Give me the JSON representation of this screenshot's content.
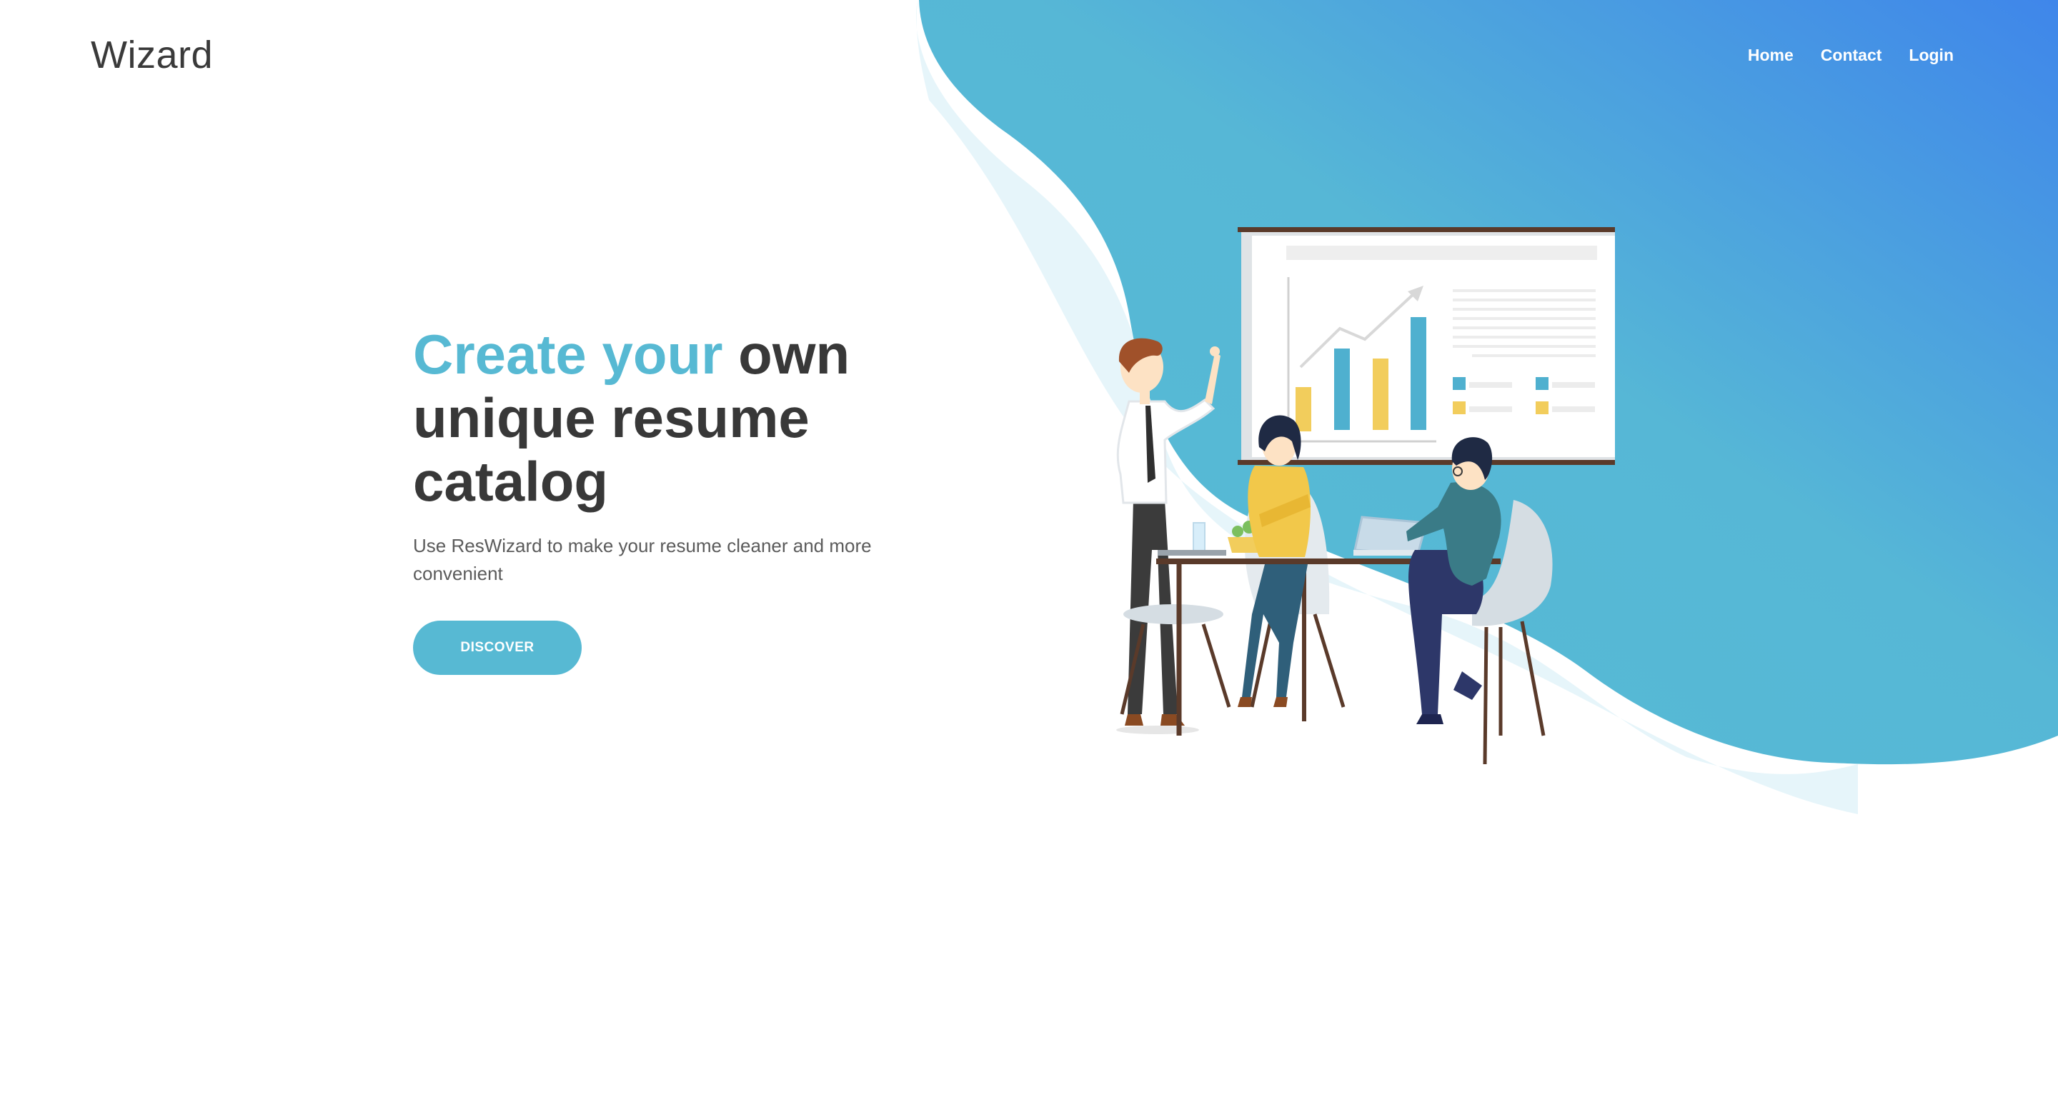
{
  "header": {
    "logo_text": "Wizard",
    "nav": [
      {
        "label": "Home"
      },
      {
        "label": "Contact"
      },
      {
        "label": "Login"
      }
    ]
  },
  "hero": {
    "headline_accent": "Create your",
    "headline_rest_1": " own",
    "headline_rest_2": "unique resume",
    "headline_rest_3": "catalog",
    "subtitle": "Use ResWizard to make your resume cleaner and more convenient",
    "cta_label": "DISCOVER"
  },
  "colors": {
    "accent": "#57b9d3",
    "text_dark": "#383838",
    "blob_light": "#e6f5fa",
    "blob_gradient_start": "#57bcd3",
    "blob_gradient_end": "#3f86ea"
  },
  "illustration": {
    "icon": "team-meeting-illustration"
  }
}
